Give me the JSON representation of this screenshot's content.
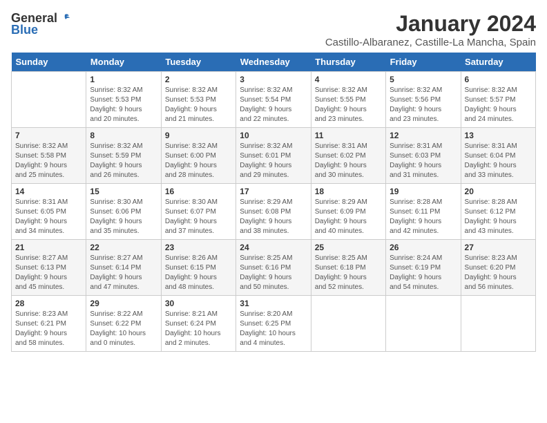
{
  "logo": {
    "general": "General",
    "blue": "Blue"
  },
  "title": "January 2024",
  "subtitle": "Castillo-Albaranez, Castille-La Mancha, Spain",
  "days_of_week": [
    "Sunday",
    "Monday",
    "Tuesday",
    "Wednesday",
    "Thursday",
    "Friday",
    "Saturday"
  ],
  "weeks": [
    [
      {
        "day": "",
        "info": ""
      },
      {
        "day": "1",
        "info": "Sunrise: 8:32 AM\nSunset: 5:53 PM\nDaylight: 9 hours\nand 20 minutes."
      },
      {
        "day": "2",
        "info": "Sunrise: 8:32 AM\nSunset: 5:53 PM\nDaylight: 9 hours\nand 21 minutes."
      },
      {
        "day": "3",
        "info": "Sunrise: 8:32 AM\nSunset: 5:54 PM\nDaylight: 9 hours\nand 22 minutes."
      },
      {
        "day": "4",
        "info": "Sunrise: 8:32 AM\nSunset: 5:55 PM\nDaylight: 9 hours\nand 23 minutes."
      },
      {
        "day": "5",
        "info": "Sunrise: 8:32 AM\nSunset: 5:56 PM\nDaylight: 9 hours\nand 23 minutes."
      },
      {
        "day": "6",
        "info": "Sunrise: 8:32 AM\nSunset: 5:57 PM\nDaylight: 9 hours\nand 24 minutes."
      }
    ],
    [
      {
        "day": "7",
        "info": "Sunrise: 8:32 AM\nSunset: 5:58 PM\nDaylight: 9 hours\nand 25 minutes."
      },
      {
        "day": "8",
        "info": "Sunrise: 8:32 AM\nSunset: 5:59 PM\nDaylight: 9 hours\nand 26 minutes."
      },
      {
        "day": "9",
        "info": "Sunrise: 8:32 AM\nSunset: 6:00 PM\nDaylight: 9 hours\nand 28 minutes."
      },
      {
        "day": "10",
        "info": "Sunrise: 8:32 AM\nSunset: 6:01 PM\nDaylight: 9 hours\nand 29 minutes."
      },
      {
        "day": "11",
        "info": "Sunrise: 8:31 AM\nSunset: 6:02 PM\nDaylight: 9 hours\nand 30 minutes."
      },
      {
        "day": "12",
        "info": "Sunrise: 8:31 AM\nSunset: 6:03 PM\nDaylight: 9 hours\nand 31 minutes."
      },
      {
        "day": "13",
        "info": "Sunrise: 8:31 AM\nSunset: 6:04 PM\nDaylight: 9 hours\nand 33 minutes."
      }
    ],
    [
      {
        "day": "14",
        "info": "Sunrise: 8:31 AM\nSunset: 6:05 PM\nDaylight: 9 hours\nand 34 minutes."
      },
      {
        "day": "15",
        "info": "Sunrise: 8:30 AM\nSunset: 6:06 PM\nDaylight: 9 hours\nand 35 minutes."
      },
      {
        "day": "16",
        "info": "Sunrise: 8:30 AM\nSunset: 6:07 PM\nDaylight: 9 hours\nand 37 minutes."
      },
      {
        "day": "17",
        "info": "Sunrise: 8:29 AM\nSunset: 6:08 PM\nDaylight: 9 hours\nand 38 minutes."
      },
      {
        "day": "18",
        "info": "Sunrise: 8:29 AM\nSunset: 6:09 PM\nDaylight: 9 hours\nand 40 minutes."
      },
      {
        "day": "19",
        "info": "Sunrise: 8:28 AM\nSunset: 6:11 PM\nDaylight: 9 hours\nand 42 minutes."
      },
      {
        "day": "20",
        "info": "Sunrise: 8:28 AM\nSunset: 6:12 PM\nDaylight: 9 hours\nand 43 minutes."
      }
    ],
    [
      {
        "day": "21",
        "info": "Sunrise: 8:27 AM\nSunset: 6:13 PM\nDaylight: 9 hours\nand 45 minutes."
      },
      {
        "day": "22",
        "info": "Sunrise: 8:27 AM\nSunset: 6:14 PM\nDaylight: 9 hours\nand 47 minutes."
      },
      {
        "day": "23",
        "info": "Sunrise: 8:26 AM\nSunset: 6:15 PM\nDaylight: 9 hours\nand 48 minutes."
      },
      {
        "day": "24",
        "info": "Sunrise: 8:25 AM\nSunset: 6:16 PM\nDaylight: 9 hours\nand 50 minutes."
      },
      {
        "day": "25",
        "info": "Sunrise: 8:25 AM\nSunset: 6:18 PM\nDaylight: 9 hours\nand 52 minutes."
      },
      {
        "day": "26",
        "info": "Sunrise: 8:24 AM\nSunset: 6:19 PM\nDaylight: 9 hours\nand 54 minutes."
      },
      {
        "day": "27",
        "info": "Sunrise: 8:23 AM\nSunset: 6:20 PM\nDaylight: 9 hours\nand 56 minutes."
      }
    ],
    [
      {
        "day": "28",
        "info": "Sunrise: 8:23 AM\nSunset: 6:21 PM\nDaylight: 9 hours\nand 58 minutes."
      },
      {
        "day": "29",
        "info": "Sunrise: 8:22 AM\nSunset: 6:22 PM\nDaylight: 10 hours\nand 0 minutes."
      },
      {
        "day": "30",
        "info": "Sunrise: 8:21 AM\nSunset: 6:24 PM\nDaylight: 10 hours\nand 2 minutes."
      },
      {
        "day": "31",
        "info": "Sunrise: 8:20 AM\nSunset: 6:25 PM\nDaylight: 10 hours\nand 4 minutes."
      },
      {
        "day": "",
        "info": ""
      },
      {
        "day": "",
        "info": ""
      },
      {
        "day": "",
        "info": ""
      }
    ]
  ]
}
